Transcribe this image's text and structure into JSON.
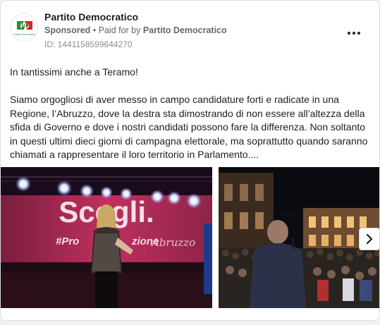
{
  "ad": {
    "advertiser": "Partito Democratico",
    "sponsored_label": "Sponsored",
    "separator": " • ",
    "paid_for_prefix": "Paid for by ",
    "paid_for_by": "Partito Democratico",
    "ad_id": "ID: 1441158599644270",
    "logo_text": "PD",
    "logo_caption": "Partito Democratico"
  },
  "body": {
    "paragraph1": "In tantissimi anche a Teramo!",
    "paragraph2": "Siamo orgogliosi di aver messo in campo candidature forti e radicate in una Regione, l’Abruzzo, dove la destra sta dimostrando di non essere all’altezza della sfida di Governo e dove i nostri candidati possono fare la differenza. Non soltanto in questi ultimi dieci giorni di campagna elettorale, ma soprattutto quando saranno chiamati a rappresentare il loro territorio in Parlamento...."
  },
  "carousel": {
    "slide1_banner_word": "Scegli.",
    "slide1_hashtag": "#Pro",
    "slide1_hashtag_tail": "zione",
    "slide1_region": "Abruzzo"
  },
  "icons": {
    "more": "more-horizontal-icon",
    "next": "chevron-right-icon"
  },
  "colors": {
    "pd_green": "#2e8b3a",
    "pd_red": "#d7262b",
    "banner_pink": "#c0305e"
  }
}
